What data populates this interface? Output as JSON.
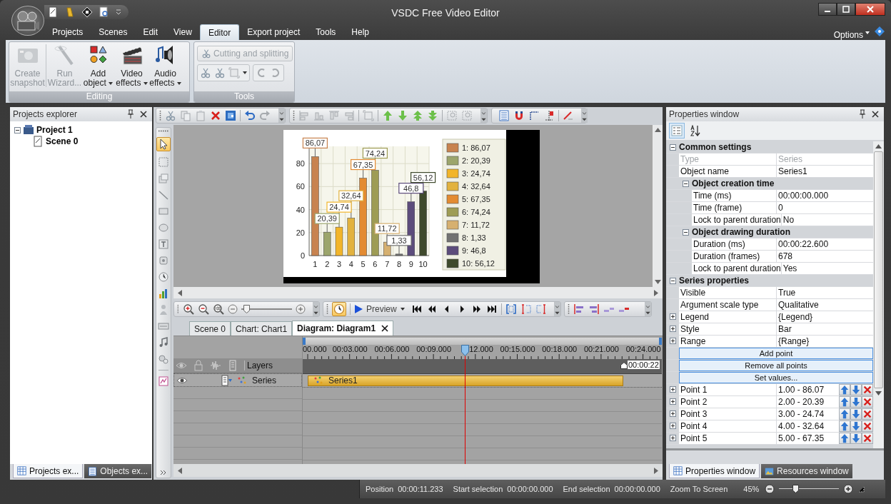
{
  "window": {
    "title": "VSDC Free Video Editor"
  },
  "menu_tabs": [
    {
      "label": "Projects",
      "selected": false
    },
    {
      "label": "Scenes",
      "selected": false
    },
    {
      "label": "Edit",
      "selected": false
    },
    {
      "label": "View",
      "selected": false
    },
    {
      "label": "Editor",
      "selected": true
    },
    {
      "label": "Export project",
      "selected": false
    },
    {
      "label": "Tools",
      "selected": false
    },
    {
      "label": "Help",
      "selected": false
    }
  ],
  "options_menu": {
    "label": "Options"
  },
  "ribbon": {
    "editing": {
      "title": "Editing",
      "items": [
        {
          "lines": [
            "Create",
            "snapshot"
          ],
          "disabled": true,
          "dropdown": false
        },
        {
          "lines": [
            "Run",
            "Wizard..."
          ],
          "disabled": true,
          "dropdown": false
        },
        {
          "lines": [
            "Add",
            "object"
          ],
          "disabled": false,
          "dropdown": true
        },
        {
          "lines": [
            "Video",
            "effects"
          ],
          "disabled": false,
          "dropdown": true
        },
        {
          "lines": [
            "Audio",
            "effects"
          ],
          "disabled": false,
          "dropdown": true
        }
      ]
    },
    "tools": {
      "title": "Tools",
      "button": {
        "label": "Cutting and splitting",
        "disabled": true
      }
    }
  },
  "projects_explorer": {
    "title": "Projects explorer",
    "tree": [
      {
        "label": "Project 1",
        "expanded": true,
        "children": [
          {
            "label": "Scene 0"
          }
        ]
      }
    ],
    "tabs": [
      {
        "label": "Projects ex...",
        "selected": true
      },
      {
        "label": "Objects ex...",
        "selected": false
      }
    ]
  },
  "scene": {
    "chart_data": {
      "type": "bar",
      "categories": [
        "1",
        "2",
        "3",
        "4",
        "5",
        "6",
        "7",
        "8",
        "9",
        "10"
      ],
      "grid": true,
      "series": [
        {
          "values": [
            86.07,
            20.39,
            24.74,
            32.64,
            67.35,
            74.24,
            11.72,
            1.33,
            46.8,
            56.12
          ]
        }
      ],
      "ylim": [
        0,
        95
      ],
      "yticks": [
        0,
        20,
        40,
        60,
        80
      ],
      "value_labels": [
        "86,07",
        "20,39",
        "24,74",
        "32,64",
        "67,35",
        "74,24",
        "11,72",
        "1,33",
        "46,8",
        "56,12"
      ]
    },
    "legend": [
      {
        "label": "1: 86,07",
        "color": "#c8834f"
      },
      {
        "label": "2: 20,39",
        "color": "#9ca56c"
      },
      {
        "label": "3: 24,74",
        "color": "#f2b52a"
      },
      {
        "label": "4: 32,64",
        "color": "#e2b23e"
      },
      {
        "label": "5: 67,35",
        "color": "#e38b32"
      },
      {
        "label": "6: 74,24",
        "color": "#9e9c55"
      },
      {
        "label": "7: 11,72",
        "color": "#d6b070"
      },
      {
        "label": "8: 1,33",
        "color": "#727272"
      },
      {
        "label": "9: 46,8",
        "color": "#5c4c7c"
      },
      {
        "label": "10: 56,12",
        "color": "#3f4a2c"
      }
    ]
  },
  "timeline_zoom": {
    "level": 0.1
  },
  "preview_button": {
    "label": "Preview"
  },
  "document_tabs": [
    {
      "label": "Scene 0",
      "selected": false
    },
    {
      "label": "Chart: Chart1",
      "selected": false
    },
    {
      "label": "Diagram: Diagram1",
      "selected": true
    }
  ],
  "timeline": {
    "ruler_labels": [
      "00.000",
      "00:03.000",
      "00:06.000",
      "00:09.000",
      "12.000",
      "00:15.000",
      "00:18.000",
      "00:21.000",
      "00:24.000"
    ],
    "playhead": {
      "level": 0.451
    },
    "end_marker": "00:00:22",
    "layers_header": "Layers",
    "layers": [
      {
        "name": "Series",
        "clip": "Series1"
      }
    ]
  },
  "properties": {
    "title": "Properties window",
    "view_buttons": [
      {
        "selected": true
      },
      {
        "selected": false
      }
    ],
    "rows": [
      {
        "kind": "category",
        "label": "Common settings",
        "expanded": true,
        "children": [
          {
            "kind": "property",
            "name": "Type",
            "value": "Series",
            "disabled": true
          },
          {
            "kind": "property",
            "name": "Object name",
            "value": "Series1",
            "disabled": false
          },
          {
            "kind": "category",
            "label": "Object creation time",
            "expanded": true,
            "children": [
              {
                "kind": "property",
                "name": "Time (ms)",
                "value": "00:00:00.000",
                "disabled": false
              },
              {
                "kind": "property",
                "name": "Time (frame)",
                "value": "0",
                "disabled": false
              },
              {
                "kind": "property",
                "name": "Lock to parent duration",
                "value": "No",
                "disabled": false
              }
            ]
          },
          {
            "kind": "category",
            "label": "Object drawing duration",
            "expanded": true,
            "children": [
              {
                "kind": "property",
                "name": "Duration (ms)",
                "value": "00:00:22.600",
                "disabled": false
              },
              {
                "kind": "property",
                "name": "Duration (frames)",
                "value": "678",
                "disabled": false
              },
              {
                "kind": "property",
                "name": "Lock to parent duration",
                "value": "Yes",
                "disabled": false
              }
            ]
          }
        ]
      },
      {
        "kind": "category",
        "label": "Series properties",
        "expanded": true,
        "children": [
          {
            "kind": "property",
            "name": "Visible",
            "value": "True",
            "disabled": false
          },
          {
            "kind": "property",
            "name": "Argument scale type",
            "value": "Qualitative",
            "disabled": false
          },
          {
            "kind": "expandable",
            "name": "Legend",
            "value": "{Legend}",
            "expanded": false
          },
          {
            "kind": "expandable",
            "name": "Style",
            "value": "Bar",
            "expanded": false
          },
          {
            "kind": "expandable",
            "name": "Range",
            "value": "{Range}",
            "expanded": false
          },
          {
            "kind": "action",
            "label": "Add point"
          },
          {
            "kind": "action",
            "label": "Remove all points"
          },
          {
            "kind": "action",
            "label": "Set values..."
          },
          {
            "kind": "point",
            "name": "Point 1",
            "value": "1.00 - 86.07",
            "expanded": false
          },
          {
            "kind": "point",
            "name": "Point 2",
            "value": "2.00 - 20.39",
            "expanded": false
          },
          {
            "kind": "point",
            "name": "Point 3",
            "value": "3.00 - 24.74",
            "expanded": false
          },
          {
            "kind": "point",
            "name": "Point 4",
            "value": "4.00 - 32.64",
            "expanded": false
          },
          {
            "kind": "point",
            "name": "Point 5",
            "value": "5.00 - 67.35",
            "expanded": false
          }
        ]
      }
    ],
    "tabs": [
      {
        "label": "Properties window",
        "selected": true
      },
      {
        "label": "Resources window",
        "selected": false
      }
    ]
  },
  "status_bar": {
    "items": [
      {
        "label": "Position",
        "value": "00:00:11.233"
      },
      {
        "label": "Start selection",
        "value": "00:00:00.000"
      },
      {
        "label": "End selection",
        "value": "00:00:00.000"
      }
    ],
    "zoom_mode": "Zoom To Screen",
    "zoom": "45%",
    "zoom_slider": {
      "level": 0.27
    }
  }
}
